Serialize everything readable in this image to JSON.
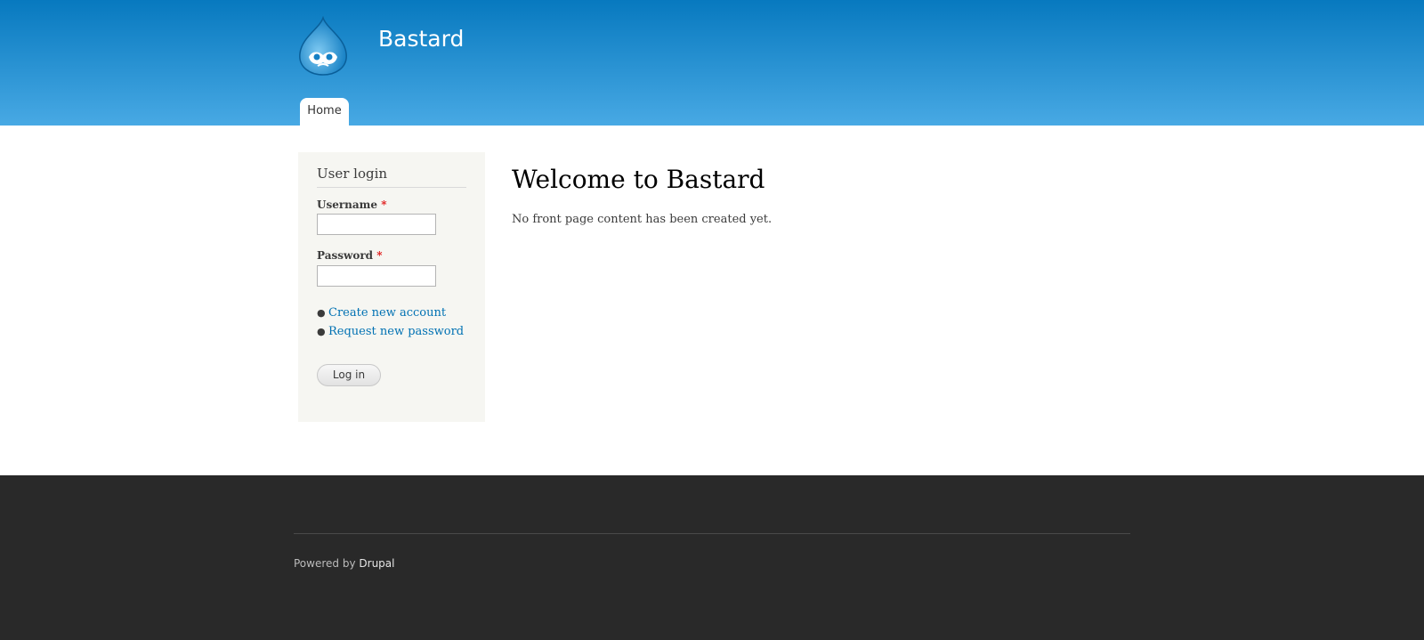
{
  "header": {
    "site_name": "Bastard",
    "logo_icon": "drupal-drop-icon",
    "tabs": [
      {
        "label": "Home"
      }
    ]
  },
  "sidebar": {
    "block_title": "User login",
    "username": {
      "label": "Username",
      "required_mark": "*",
      "value": "",
      "placeholder": ""
    },
    "password": {
      "label": "Password",
      "required_mark": "*",
      "value": "",
      "placeholder": ""
    },
    "links": [
      {
        "label": "Create new account"
      },
      {
        "label": "Request new password"
      }
    ],
    "login_label": "Log in"
  },
  "main": {
    "title": "Welcome to Bastard",
    "text": "No front page content has been created yet."
  },
  "footer": {
    "powered_by": "Powered by",
    "link_label": "Drupal"
  },
  "colors": {
    "header_top": "#0779bf",
    "header_bottom": "#48a9e4",
    "link": "#0071b3",
    "required": "#e01818",
    "footer_bg": "#292929",
    "sidebar_bg": "#f6f6f2"
  }
}
